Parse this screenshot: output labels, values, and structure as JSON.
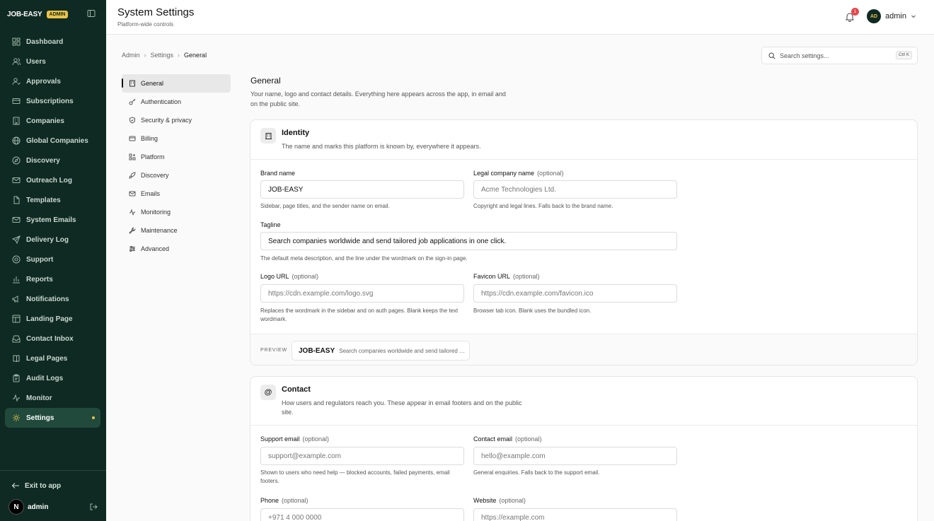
{
  "sidebar": {
    "brand": "JOB-EASY",
    "badge": "ADMIN",
    "items": [
      {
        "label": "Dashboard",
        "icon": "dashboard-icon"
      },
      {
        "label": "Users",
        "icon": "users-icon"
      },
      {
        "label": "Approvals",
        "icon": "user-check-icon"
      },
      {
        "label": "Subscriptions",
        "icon": "credit-card-icon"
      },
      {
        "label": "Companies",
        "icon": "building-icon"
      },
      {
        "label": "Global Companies",
        "icon": "globe-icon"
      },
      {
        "label": "Discovery",
        "icon": "compass-icon"
      },
      {
        "label": "Outreach Log",
        "icon": "mail-icon"
      },
      {
        "label": "Templates",
        "icon": "file-icon"
      },
      {
        "label": "System Emails",
        "icon": "mail-icon"
      },
      {
        "label": "Delivery Log",
        "icon": "send-icon"
      },
      {
        "label": "Support",
        "icon": "lifebuoy-icon"
      },
      {
        "label": "Reports",
        "icon": "bar-chart-icon"
      },
      {
        "label": "Notifications",
        "icon": "megaphone-icon"
      },
      {
        "label": "Landing Page",
        "icon": "layout-icon"
      },
      {
        "label": "Contact Inbox",
        "icon": "inbox-icon"
      },
      {
        "label": "Legal Pages",
        "icon": "book-icon"
      },
      {
        "label": "Audit Logs",
        "icon": "clipboard-icon"
      },
      {
        "label": "Monitor",
        "icon": "activity-icon"
      },
      {
        "label": "Settings",
        "icon": "gear-icon"
      }
    ],
    "exit_label": "Exit to app",
    "user_initial": "N",
    "user_name": "admin"
  },
  "header": {
    "title": "System Settings",
    "subtitle": "Platform-wide controls",
    "notification_count": "1",
    "avatar_initials": "AD",
    "user_name": "admin"
  },
  "breadcrumb": [
    "Admin",
    "Settings",
    "General"
  ],
  "search": {
    "placeholder": "Search settings...",
    "shortcut": "Ctrl K"
  },
  "settings_nav": [
    {
      "label": "General",
      "icon": "building-icon"
    },
    {
      "label": "Authentication",
      "icon": "key-icon"
    },
    {
      "label": "Security & privacy",
      "icon": "shield-icon"
    },
    {
      "label": "Billing",
      "icon": "credit-card-icon"
    },
    {
      "label": "Platform",
      "icon": "grid-plus-icon"
    },
    {
      "label": "Discovery",
      "icon": "rocket-icon"
    },
    {
      "label": "Emails",
      "icon": "mail-icon"
    },
    {
      "label": "Monitoring",
      "icon": "activity-icon"
    },
    {
      "label": "Maintenance",
      "icon": "wrench-icon"
    },
    {
      "label": "Advanced",
      "icon": "sliders-icon"
    }
  ],
  "section": {
    "title": "General",
    "description": "Your name, logo and contact details. Everything here appears across the app, in email and on the public site."
  },
  "identity": {
    "title": "Identity",
    "description": "The name and marks this platform is known by, everywhere it appears.",
    "brand_name": {
      "label": "Brand name",
      "value": "JOB-EASY",
      "help": "Sidebar, page titles, and the sender name on email."
    },
    "legal_name": {
      "label": "Legal company name",
      "optional": "(optional)",
      "placeholder": "Acme Technologies Ltd.",
      "help": "Copyright and legal lines. Falls back to the brand name."
    },
    "tagline": {
      "label": "Tagline",
      "value": "Search companies worldwide and send tailored job applications in one click.",
      "help": "The default meta description, and the line under the wordmark on the sign-in page."
    },
    "logo_url": {
      "label": "Logo URL",
      "optional": "(optional)",
      "placeholder": "https://cdn.example.com/logo.svg",
      "help": "Replaces the wordmark in the sidebar and on auth pages. Blank keeps the text wordmark."
    },
    "favicon_url": {
      "label": "Favicon URL",
      "optional": "(optional)",
      "placeholder": "https://cdn.example.com/favicon.ico",
      "help": "Browser tab icon. Blank uses the bundled icon."
    },
    "preview": {
      "label": "PREVIEW",
      "brand": "JOB-EASY",
      "tagline": "Search companies worldwide and send tailored job applications in one click."
    }
  },
  "contact": {
    "title": "Contact",
    "icon_glyph": "@",
    "description": "How users and regulators reach you. These appear in email footers and on the public site.",
    "support_email": {
      "label": "Support email",
      "optional": "(optional)",
      "placeholder": "support@example.com",
      "help": "Shown to users who need help — blocked accounts, failed payments, email footers."
    },
    "contact_email": {
      "label": "Contact email",
      "optional": "(optional)",
      "placeholder": "hello@example.com",
      "help": "General enquiries. Falls back to the support email."
    },
    "phone": {
      "label": "Phone",
      "optional": "(optional)",
      "placeholder": "+971 4 000 0000"
    },
    "website": {
      "label": "Website",
      "optional": "(optional)",
      "placeholder": "https://example.com"
    }
  },
  "colors": {
    "sidebar_bg": "#0f2a22",
    "accent": "#e9c24a",
    "badge_red": "#e5484d"
  }
}
